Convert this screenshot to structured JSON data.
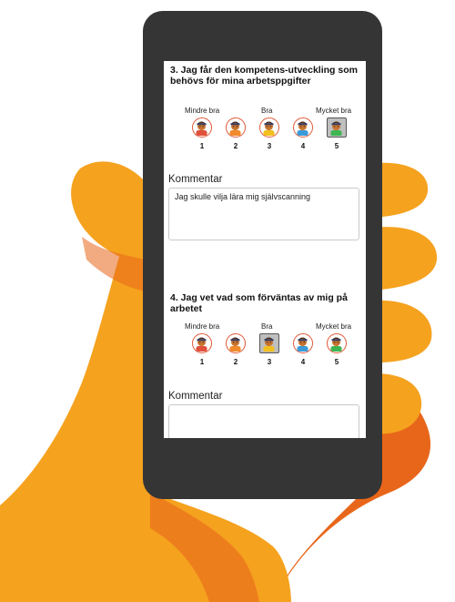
{
  "questions": [
    {
      "title": "3. Jag får den kompetens-utveckling som behövs för mina arbetsppgifter",
      "scale_labels": {
        "low": "Mindre bra",
        "mid": "Bra",
        "high": "Mycket bra"
      },
      "options": [
        "1",
        "2",
        "3",
        "4",
        "5"
      ],
      "selected_option": "5",
      "comment_label": "Kommentar",
      "comment_value": "Jag skulle vilja lära mig självscanning"
    },
    {
      "title": "4. Jag vet vad som förväntas av mig på arbetet",
      "scale_labels": {
        "low": "Mindre bra",
        "mid": "Bra",
        "high": "Mycket bra"
      },
      "options": [
        "1",
        "2",
        "3",
        "4",
        "5"
      ],
      "selected_option": "3",
      "comment_label": "Kommentar",
      "comment_value": ""
    }
  ],
  "shirt_colors": [
    "#e0503a",
    "#f08a2a",
    "#f2c01f",
    "#3b9bd8",
    "#3fb552"
  ],
  "accent_colors": {
    "hand": "#f5a21f",
    "sleeve": "#e8661a",
    "phone": "#353535"
  }
}
